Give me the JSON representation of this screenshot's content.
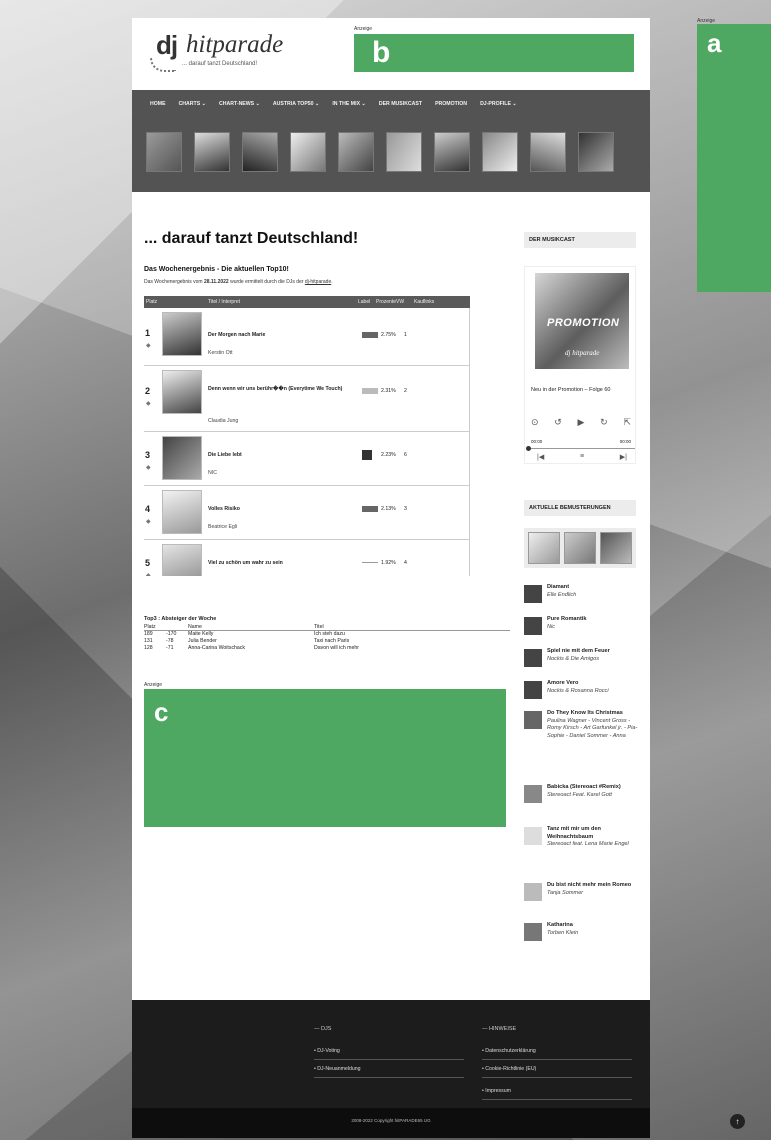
{
  "ads": {
    "label": "Anzeige",
    "a": "a",
    "b": "b",
    "c": "c"
  },
  "logo": {
    "dj": "dj",
    "hp": "hitparade",
    "tagline": "... darauf tanzt Deutschland!"
  },
  "nav": [
    "HOME",
    "CHARTS ⌄",
    "CHART-NEWS ⌄",
    "AUSTRIA TOP50 ⌄",
    "IN THE MIX ⌄",
    "DER MUSIKCAST",
    "PROMOTION",
    "DJ-PROFILE ⌄"
  ],
  "main": {
    "h1": "... darauf tanzt Deutschland!",
    "weekly_title": "Das Wochenergebnis - Die aktuellen Top10!",
    "weekly_sub_pre": "Das Wochenergebnis vom ",
    "weekly_date": "28.11.2022",
    "weekly_sub_post": " wurde ermittelt durch die DJs der ",
    "weekly_link": "dj-hitparade",
    "table_headers": {
      "platz": "Platz",
      "titel": "Titel / Interpret",
      "label": "Label",
      "prozente": "ProzenteVW",
      "kauf": "Kauflinks"
    },
    "rows": [
      {
        "rank": "1",
        "title": "Der Morgen nach Marie",
        "artist": "Kerstin Ott",
        "pct": "2.75%",
        "kauf": "1"
      },
      {
        "rank": "2",
        "title": "Denn wenn wir uns berühr��n (Everytime We Touch)",
        "artist": "Claudia Jung",
        "pct": "2.31%",
        "kauf": "2"
      },
      {
        "rank": "3",
        "title": "Die Liebe lebt",
        "artist": "NIC",
        "pct": "2.23%",
        "kauf": "6"
      },
      {
        "rank": "4",
        "title": "Volles Risiko",
        "artist": "Beatrice Egli",
        "pct": "2.13%",
        "kauf": "3"
      },
      {
        "rank": "5",
        "title": "Viel zu schön um wahr zu sein",
        "artist": "",
        "pct": "1.92%",
        "kauf": "4"
      }
    ],
    "top3_title": "Top3 : Absteiger der Woche",
    "top3_headers": {
      "platz": "Platz",
      "name": "Name",
      "titel": "Titel"
    },
    "top3": [
      {
        "platz": "189",
        "diff": "-170",
        "name": "Maite Kelly",
        "titel": "Ich steh dazu"
      },
      {
        "platz": "131",
        "diff": "-78",
        "name": "Julia Bender",
        "titel": "Taxi nach Paris"
      },
      {
        "platz": "128",
        "diff": "-71",
        "name": "Anna-Carina Woitschack",
        "titel": "Davon will ich mehr"
      }
    ]
  },
  "sidebar": {
    "musikcast_title": "DER MUSIKCAST",
    "promo_word": "PROMOTION",
    "promo_logo": "dj hitparade",
    "episode": "Neu in der Promotion – Folge 60",
    "time_start": "00:00",
    "time_end": "00:00",
    "bem_title": "AKTUELLE BEMUSTERUNGEN",
    "songs": [
      {
        "t": "Diamant",
        "a": "Elle Endlich"
      },
      {
        "t": "Pure Romantik",
        "a": "Nic"
      },
      {
        "t": "Spiel nie mit dem Feuer",
        "a": "Nockis & Die Amigos"
      },
      {
        "t": "Amore Vero",
        "a": "Nockis & Rosanna Rocci"
      },
      {
        "t": "Do They Know Its Christmas",
        "a": "Paulina Wagner - Vincent Gross - Romy Kirsch - Art Garfunkel jr. - Pia-Sophie - Daniel Sommer - Anna"
      },
      {
        "t": "Babicka (Stereoact #Remix)",
        "a": "Stereoact Feat. Karel Gott"
      },
      {
        "t": "Tanz mit mir um den Weihnachtsbaum",
        "a": "Stereoact feat. Lena Marie Engel"
      },
      {
        "t": "Du bist nicht mehr mein Romeo",
        "a": "Tanja Sommer"
      },
      {
        "t": "Katharina",
        "a": "Torben Klein"
      }
    ]
  },
  "footer": {
    "djs_title": "DJS",
    "djs_links": [
      "DJ-Voting",
      "DJ-Neuanmeldung"
    ],
    "hinweise_title": "HINWEISE",
    "hinweise_links": [
      "Datenschutzerklärung",
      "Cookie-Richtlinie (EU)",
      "Impressum"
    ],
    "copyright": "2008-2022 Copyright hitPARADE65 UG"
  },
  "colors": {
    "ad_green": "#4ea862",
    "nav_bg": "#535353",
    "footer_bg": "#1c1c1c"
  }
}
